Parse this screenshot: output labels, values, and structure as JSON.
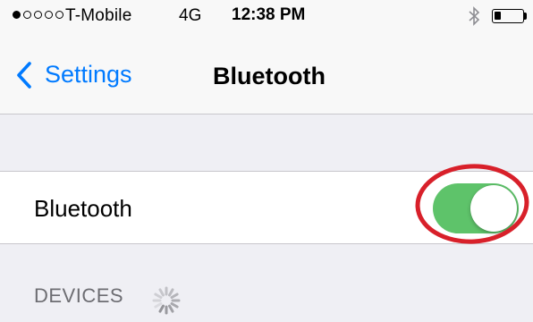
{
  "status_bar": {
    "signal_bars_total": 5,
    "signal_bars_filled": 1,
    "carrier": "T-Mobile",
    "network": "4G",
    "time": "12:38 PM",
    "battery_level": 0.25,
    "bluetooth_icon": "bluetooth-icon"
  },
  "nav": {
    "back_label": "Settings",
    "back_icon": "chevron-left-icon",
    "title": "Bluetooth"
  },
  "bluetooth_cell": {
    "label": "Bluetooth",
    "toggle_on": true,
    "toggle_color": "#5ec36a",
    "highlight_color": "#d8202a"
  },
  "devices_section": {
    "header": "DEVICES",
    "spinner_icon": "loading-spinner-icon"
  },
  "colors": {
    "accent": "#007aff",
    "background": "#efeff4",
    "cell_background": "#ffffff",
    "separator": "#c8c7cc",
    "section_text": "#6d6d72"
  }
}
